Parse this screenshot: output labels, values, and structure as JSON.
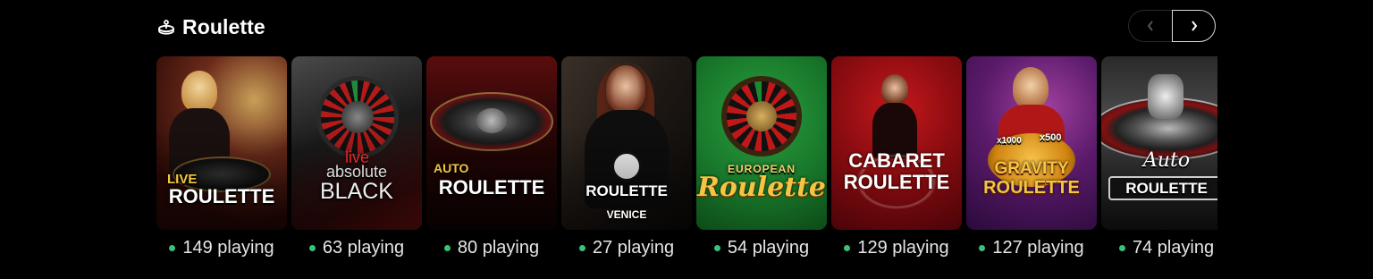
{
  "section": {
    "icon": "roulette-wheel-icon",
    "title": "Roulette"
  },
  "nav": {
    "prev_icon": "chevron-left-icon",
    "next_icon": "chevron-right-icon"
  },
  "colors": {
    "online_dot": "#39c279",
    "background": "#000000"
  },
  "games": [
    {
      "line1": "LIVE",
      "line2": "ROULETTE",
      "count": "149 playing"
    },
    {
      "line1": "live",
      "line2": "absolute",
      "line3": "BLACK",
      "count": "63 playing"
    },
    {
      "line1": "AUTO",
      "line2": "ROULETTE",
      "count": "80 playing"
    },
    {
      "line1": "ROULETTE",
      "line2": "VENICE",
      "count": "27 playing"
    },
    {
      "line1": "EUROPEAN",
      "line2": "Roulette",
      "count": "54 playing"
    },
    {
      "line1": "CABARET",
      "line2": "ROULETTE",
      "count": "129 playing"
    },
    {
      "line1": "x1000",
      "line2": "x500",
      "line3": "GRAVITY",
      "line4": "ROULETTE",
      "count": "127 playing"
    },
    {
      "line1": "Auto",
      "line2": "ROULETTE",
      "count": "74 playing"
    }
  ]
}
